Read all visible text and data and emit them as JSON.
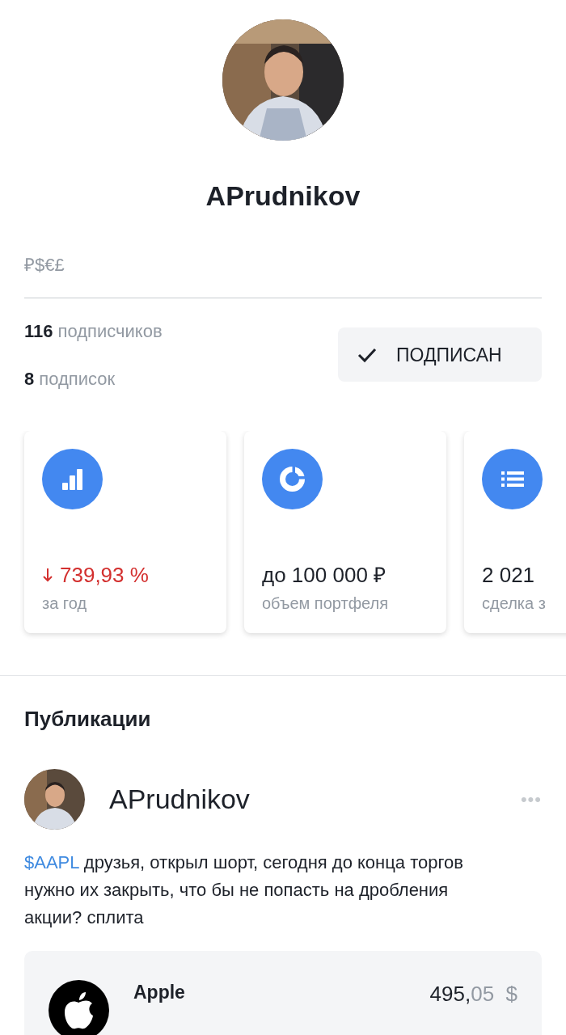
{
  "profile": {
    "name": "APrudnikov",
    "bio": "₽$€£",
    "followers": {
      "count": "116",
      "label": "подписчиков"
    },
    "following": {
      "count": "8",
      "label": "подписок"
    },
    "subscribe_button": {
      "label": "ПОДПИСАН",
      "checked": true
    }
  },
  "stats": [
    {
      "kind": "chart",
      "negative": true,
      "value": "739,93 %",
      "caption": "за год"
    },
    {
      "kind": "donut",
      "negative": false,
      "value": "до 100 000 ₽",
      "caption": "объем портфеля"
    },
    {
      "kind": "list",
      "negative": false,
      "value": "2 021",
      "caption": "сделка з"
    }
  ],
  "publications": {
    "title": "Публикации",
    "post": {
      "author": "APrudnikov",
      "more": "•••",
      "ticker": "$AAPL",
      "text": "друзья, открыл шорт, сегодня до конца торгов нужно их закрыть, что бы не попасть на дробления акции? сплита",
      "instrument": {
        "name": "Apple",
        "price_integer": "495,",
        "price_fraction": "05",
        "currency": "$"
      }
    }
  }
}
